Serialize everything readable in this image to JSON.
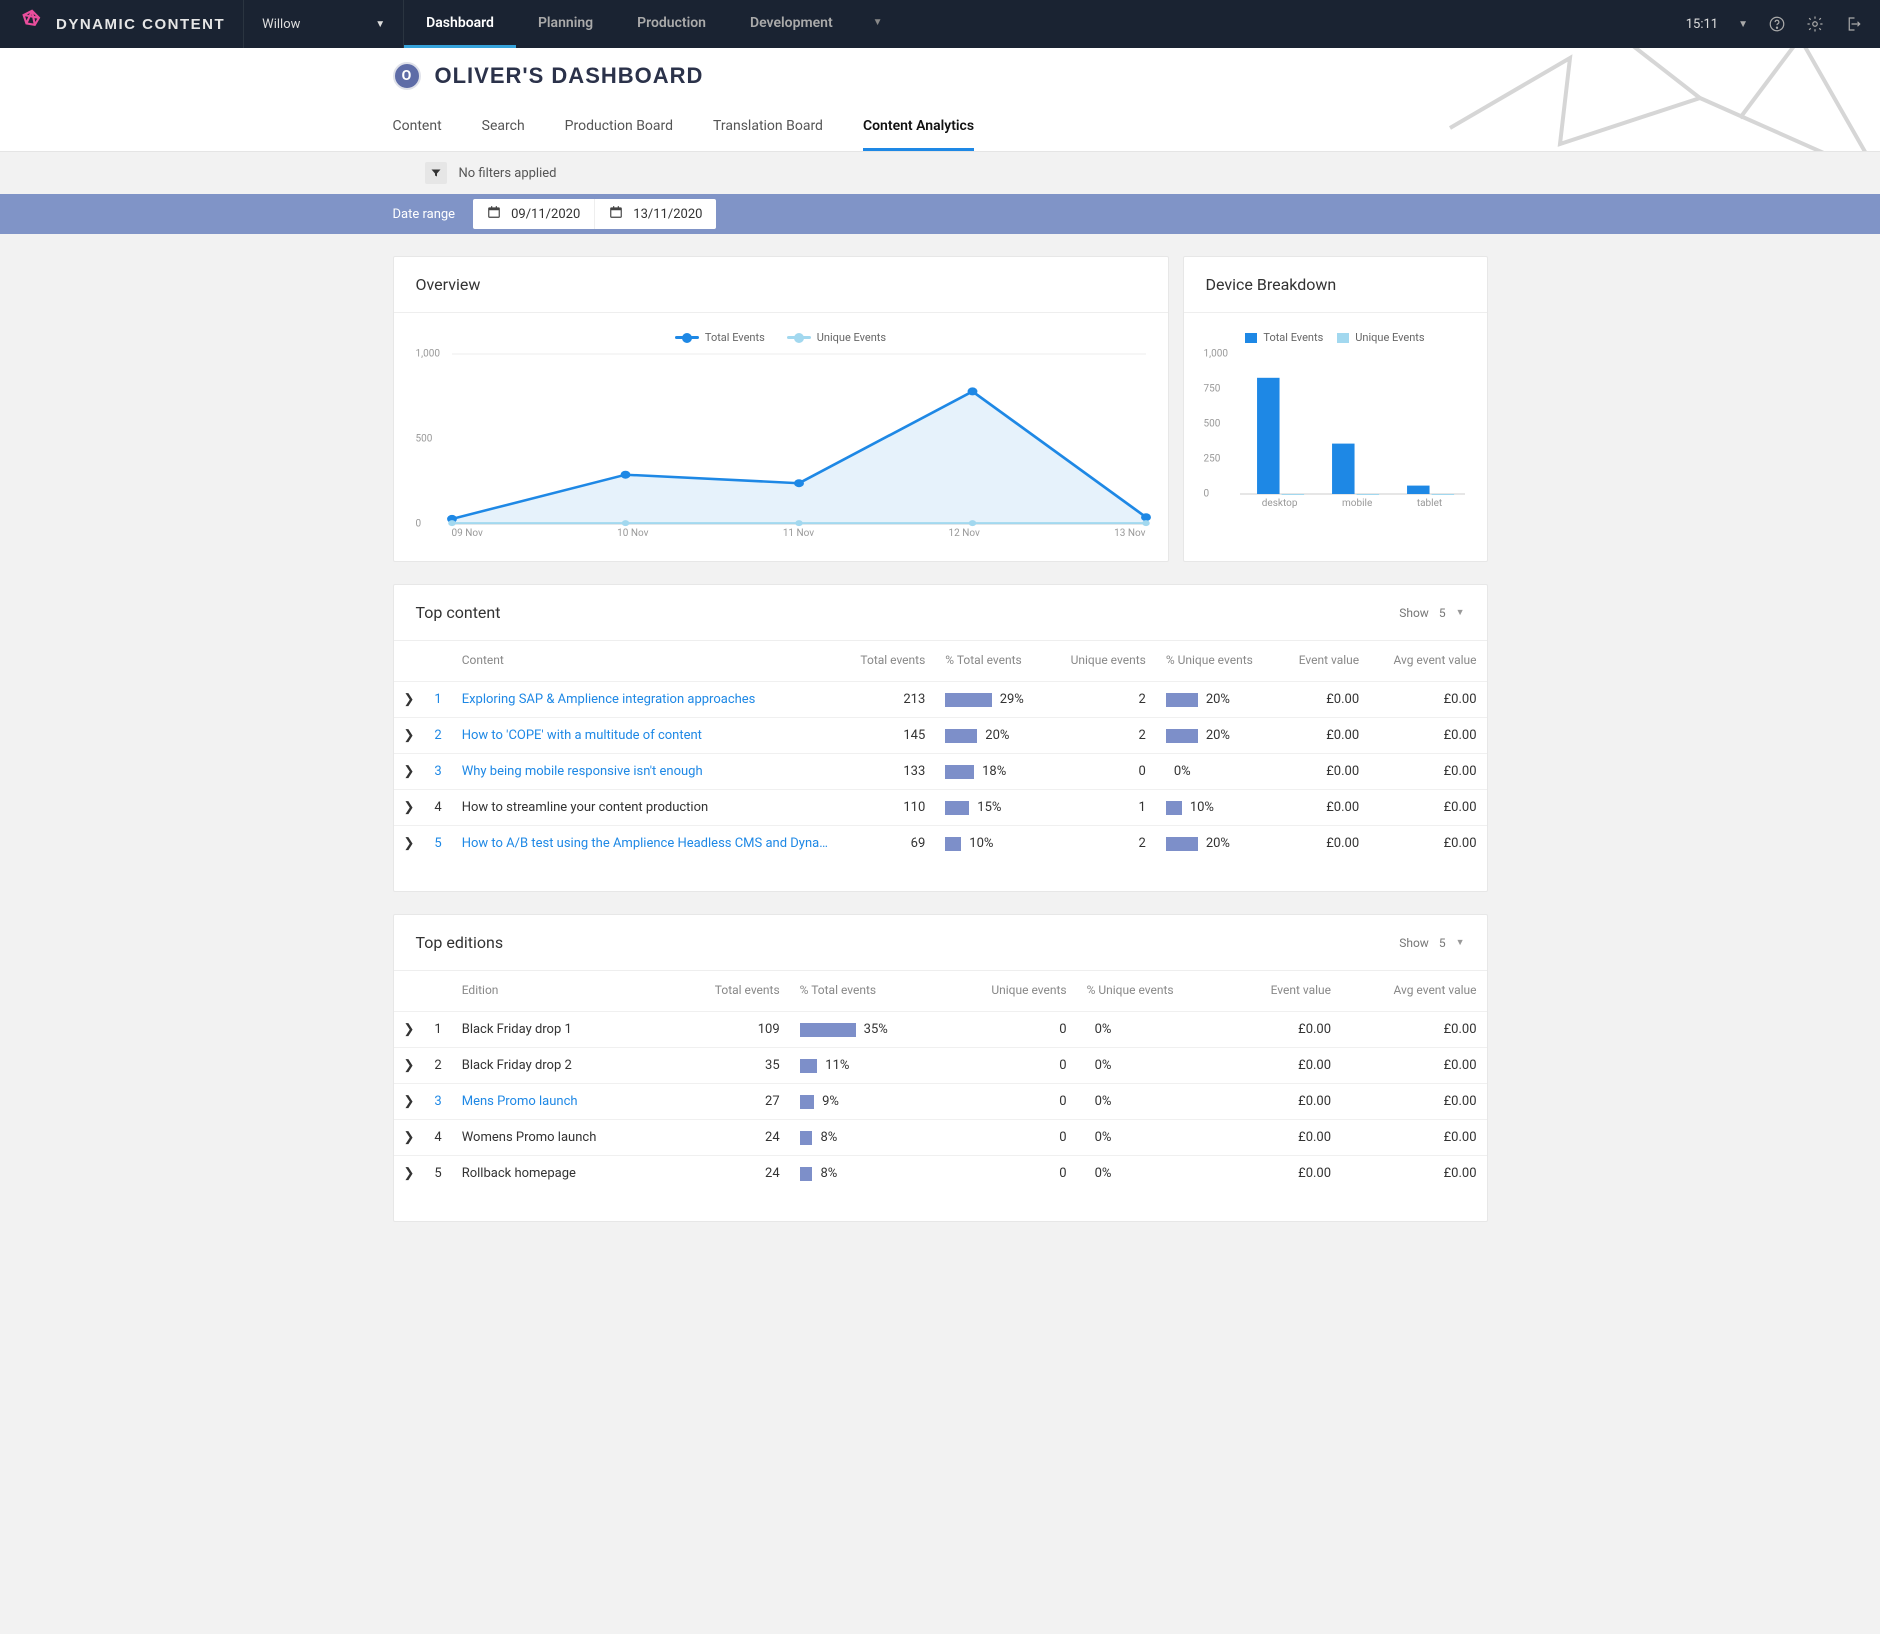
{
  "brand": "DYNAMIC CONTENT",
  "hub": "Willow",
  "mainTabs": [
    "Dashboard",
    "Planning",
    "Production",
    "Development"
  ],
  "activeMainTab": "Dashboard",
  "time": "15:11",
  "pageOwnerInitial": "O",
  "pageTitle": "OLIVER'S DASHBOARD",
  "subtabs": [
    "Content",
    "Search",
    "Production Board",
    "Translation Board",
    "Content Analytics"
  ],
  "activeSubtab": "Content Analytics",
  "filterText": "No filters applied",
  "dateRangeLabel": "Date range",
  "dateFrom": "09/11/2020",
  "dateTo": "13/11/2020",
  "overview": {
    "title": "Overview",
    "legend": {
      "total": "Total Events",
      "unique": "Unique Events"
    },
    "yTicks": [
      "1,000",
      "500",
      "0"
    ]
  },
  "device": {
    "title": "Device Breakdown",
    "legend": {
      "total": "Total Events",
      "unique": "Unique Events"
    },
    "yTicks": [
      "1,000",
      "750",
      "500",
      "250",
      "0"
    ]
  },
  "topContent": {
    "title": "Top content",
    "showLabel": "Show",
    "showValue": "5",
    "headers": [
      "Content",
      "Total events",
      "% Total events",
      "Unique events",
      "% Unique events",
      "Event value",
      "Avg event value"
    ],
    "rows": [
      {
        "idx": "1",
        "name": "Exploring SAP & Amplience integration approaches",
        "total": "213",
        "pctTotal": "29%",
        "pctTotalW": 29,
        "unique": "2",
        "pctUnique": "20%",
        "pctUniqueW": 20,
        "ev": "£0.00",
        "avg": "£0.00",
        "link": true
      },
      {
        "idx": "2",
        "name": "How to 'COPE' with a multitude of content",
        "total": "145",
        "pctTotal": "20%",
        "pctTotalW": 20,
        "unique": "2",
        "pctUnique": "20%",
        "pctUniqueW": 20,
        "ev": "£0.00",
        "avg": "£0.00",
        "link": true
      },
      {
        "idx": "3",
        "name": "Why being mobile responsive isn't enough",
        "total": "133",
        "pctTotal": "18%",
        "pctTotalW": 18,
        "unique": "0",
        "pctUnique": "0%",
        "pctUniqueW": 0,
        "ev": "£0.00",
        "avg": "£0.00",
        "link": true
      },
      {
        "idx": "4",
        "name": "How to streamline your content production",
        "total": "110",
        "pctTotal": "15%",
        "pctTotalW": 15,
        "unique": "1",
        "pctUnique": "10%",
        "pctUniqueW": 10,
        "ev": "£0.00",
        "avg": "£0.00",
        "link": false
      },
      {
        "idx": "5",
        "name": "How to A/B test using the Amplience Headless CMS and Dynamic Yield Experience Optimization",
        "total": "69",
        "pctTotal": "10%",
        "pctTotalW": 10,
        "unique": "2",
        "pctUnique": "20%",
        "pctUniqueW": 20,
        "ev": "£0.00",
        "avg": "£0.00",
        "link": true
      }
    ]
  },
  "topEditions": {
    "title": "Top editions",
    "showLabel": "Show",
    "showValue": "5",
    "headers": [
      "Edition",
      "Total events",
      "% Total events",
      "Unique events",
      "% Unique events",
      "Event value",
      "Avg event value"
    ],
    "rows": [
      {
        "idx": "1",
        "name": "Black Friday drop 1",
        "total": "109",
        "pctTotal": "35%",
        "pctTotalW": 35,
        "unique": "0",
        "pctUnique": "0%",
        "pctUniqueW": 0,
        "ev": "£0.00",
        "avg": "£0.00",
        "link": false
      },
      {
        "idx": "2",
        "name": "Black Friday drop 2",
        "total": "35",
        "pctTotal": "11%",
        "pctTotalW": 11,
        "unique": "0",
        "pctUnique": "0%",
        "pctUniqueW": 0,
        "ev": "£0.00",
        "avg": "£0.00",
        "link": false
      },
      {
        "idx": "3",
        "name": "Mens Promo launch",
        "total": "27",
        "pctTotal": "9%",
        "pctTotalW": 9,
        "unique": "0",
        "pctUnique": "0%",
        "pctUniqueW": 0,
        "ev": "£0.00",
        "avg": "£0.00",
        "link": true
      },
      {
        "idx": "4",
        "name": "Womens Promo launch",
        "total": "24",
        "pctTotal": "8%",
        "pctTotalW": 8,
        "unique": "0",
        "pctUnique": "0%",
        "pctUniqueW": 0,
        "ev": "£0.00",
        "avg": "£0.00",
        "link": false
      },
      {
        "idx": "5",
        "name": "Rollback homepage",
        "total": "24",
        "pctTotal": "8%",
        "pctTotalW": 8,
        "unique": "0",
        "pctUnique": "0%",
        "pctUniqueW": 0,
        "ev": "£0.00",
        "avg": "£0.00",
        "link": false
      }
    ]
  },
  "chart_data": [
    {
      "type": "line",
      "title": "Overview",
      "x": [
        "09 Nov",
        "10 Nov",
        "11 Nov",
        "12 Nov",
        "13 Nov"
      ],
      "series": [
        {
          "name": "Total Events",
          "values": [
            30,
            290,
            240,
            780,
            40
          ]
        },
        {
          "name": "Unique Events",
          "values": [
            5,
            5,
            5,
            5,
            5
          ]
        }
      ],
      "ylim": [
        0,
        1000
      ],
      "xlabel": "",
      "ylabel": ""
    },
    {
      "type": "bar",
      "title": "Device Breakdown",
      "categories": [
        "desktop",
        "mobile",
        "tablet"
      ],
      "series": [
        {
          "name": "Total Events",
          "values": [
            830,
            360,
            60
          ]
        },
        {
          "name": "Unique Events",
          "values": [
            0,
            0,
            0
          ]
        }
      ],
      "ylim": [
        0,
        1000
      ],
      "xlabel": "",
      "ylabel": ""
    }
  ]
}
